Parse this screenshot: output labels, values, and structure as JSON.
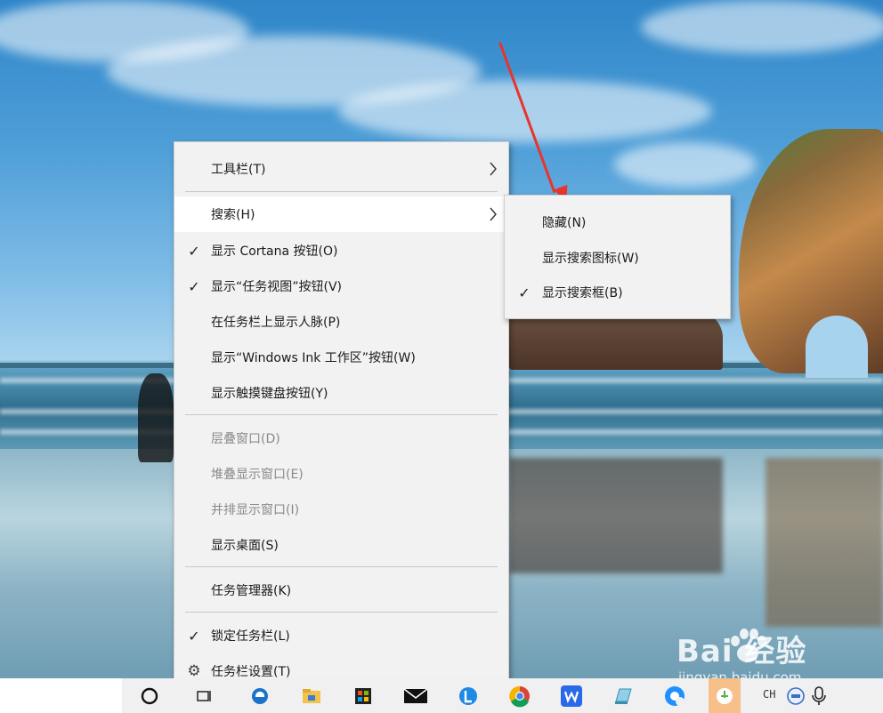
{
  "context_menu": {
    "items": [
      {
        "label": "工具栏(T)",
        "checked": false,
        "has_submenu": true,
        "disabled": false
      },
      {
        "label": "搜索(H)",
        "checked": false,
        "has_submenu": true,
        "disabled": false,
        "highlighted": true
      },
      {
        "label": "显示 Cortana 按钮(O)",
        "checked": true,
        "has_submenu": false,
        "disabled": false
      },
      {
        "label": "显示“任务视图”按钮(V)",
        "checked": true,
        "has_submenu": false,
        "disabled": false
      },
      {
        "label": "在任务栏上显示人脉(P)",
        "checked": false,
        "has_submenu": false,
        "disabled": false
      },
      {
        "label": "显示“Windows Ink 工作区”按钮(W)",
        "checked": false,
        "has_submenu": false,
        "disabled": false
      },
      {
        "label": "显示触摸键盘按钮(Y)",
        "checked": false,
        "has_submenu": false,
        "disabled": false
      },
      {
        "label": "层叠窗口(D)",
        "checked": false,
        "has_submenu": false,
        "disabled": true
      },
      {
        "label": "堆叠显示窗口(E)",
        "checked": false,
        "has_submenu": false,
        "disabled": true
      },
      {
        "label": "并排显示窗口(I)",
        "checked": false,
        "has_submenu": false,
        "disabled": true
      },
      {
        "label": "显示桌面(S)",
        "checked": false,
        "has_submenu": false,
        "disabled": false
      },
      {
        "label": "任务管理器(K)",
        "checked": false,
        "has_submenu": false,
        "disabled": false
      },
      {
        "label": "锁定任务栏(L)",
        "checked": true,
        "has_submenu": false,
        "disabled": false
      },
      {
        "label": "任务栏设置(T)",
        "checked": false,
        "has_submenu": false,
        "disabled": false,
        "icon": "gear-icon"
      }
    ]
  },
  "search_submenu": {
    "items": [
      {
        "label": "隐藏(N)",
        "checked": false
      },
      {
        "label": "显示搜索图标(W)",
        "checked": false
      },
      {
        "label": "显示搜索框(B)",
        "checked": true
      }
    ]
  },
  "glyphs": {
    "check": "✓",
    "chevron": "〉",
    "gear": "⚙"
  },
  "taskbar": {
    "tray_lang": "CH"
  },
  "watermark": {
    "main": "Bai  经验",
    "sub": "jingyan.baidu.com"
  },
  "colors": {
    "menu_bg": "#f2f2f2",
    "menu_hover": "#ffffff",
    "disabled_text": "#8a8a8a",
    "arrow": "#e8342c"
  }
}
